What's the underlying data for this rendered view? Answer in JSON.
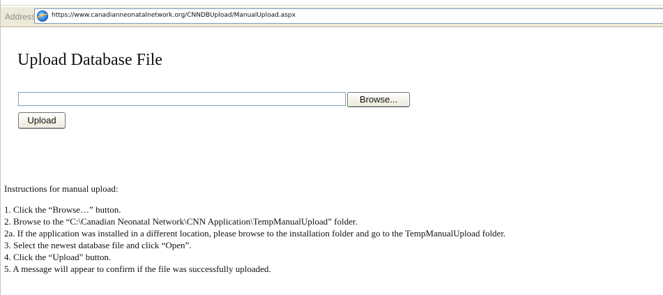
{
  "browser": {
    "address_label": "Address",
    "url": "https://www.canadianneonatalnetwork.org/CNNDBUpload/ManualUpload.aspx",
    "icon": "ie-page-icon"
  },
  "page": {
    "title": "Upload Database File",
    "file_input": {
      "value": "",
      "placeholder": ""
    },
    "browse_label": "Browse...",
    "upload_label": "Upload",
    "instructions": {
      "heading": "Instructions for manual upload:",
      "steps": [
        "1. Click the “Browse…” button.",
        "2. Browse to the “C:\\Canadian Neonatal Network\\CNN Application\\TempManualUpload” folder.",
        "2a. If the application was installed in a different location, please browse to the installation folder and go to the TempManualUpload folder.",
        "3. Select the newest database file and click “Open”.",
        "4. Click the “Upload” button.",
        "5. A message will appear to confirm if the file was successfully uploaded."
      ]
    }
  },
  "colors": {
    "chrome": "#ece9d8",
    "address_border": "#7f9db9",
    "text": "#111111"
  }
}
